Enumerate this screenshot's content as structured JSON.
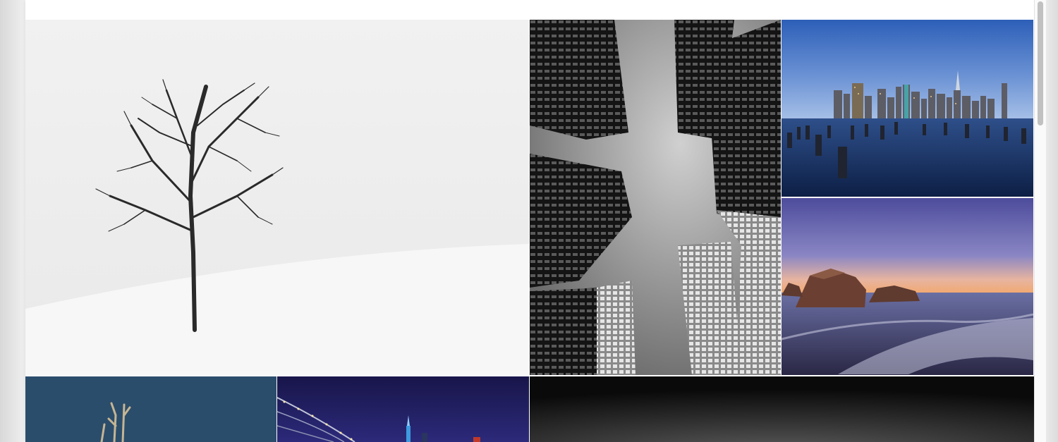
{
  "gallery": {
    "photos": [
      {
        "subject": "lone-bare-tree-in-snow"
      },
      {
        "subject": "skyscrapers-looking-up"
      },
      {
        "subject": "city-skyline-with-pier-posts"
      },
      {
        "subject": "rocky-beach-at-dusk"
      },
      {
        "subject": "bare-branches-against-blue"
      },
      {
        "subject": "bridge-and-skyline-at-night"
      },
      {
        "subject": "dark-gradient-photo"
      }
    ]
  },
  "colors": {
    "page_background": "#ffffff",
    "gutter": "#f0f0f0",
    "scroll_thumb": "#c1c1c1"
  },
  "scroll": {
    "position_fraction": 0.0
  }
}
